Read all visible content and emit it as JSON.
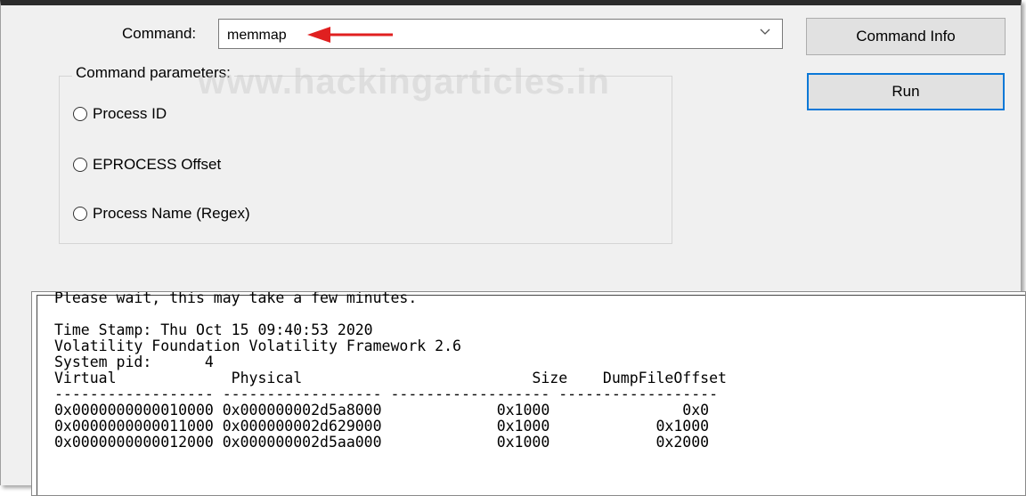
{
  "command": {
    "label": "Command:",
    "value": "memmap"
  },
  "buttons": {
    "command_info": "Command Info",
    "run": "Run"
  },
  "parameters": {
    "title": "Command parameters:",
    "options": [
      "Process ID",
      "EPROCESS Offset",
      "Process Name (Regex)"
    ]
  },
  "watermark": "www.hackingarticles.in",
  "output": {
    "lines": [
      "Please wait, this may take a few minutes.",
      "",
      "Time Stamp: Thu Oct 15 09:40:53 2020",
      "Volatility Foundation Volatility Framework 2.6",
      "System pid:      4",
      "Virtual             Physical                          Size    DumpFileOffset",
      "------------------ ------------------ ------------------ ------------------",
      "0x0000000000010000 0x000000002d5a8000             0x1000               0x0",
      "0x0000000000011000 0x000000002d629000             0x1000            0x1000",
      "0x0000000000012000 0x000000002d5aa000             0x1000            0x2000"
    ]
  },
  "colors": {
    "annotation_arrow": "#e02020",
    "run_focus_border": "#0a78d7"
  }
}
